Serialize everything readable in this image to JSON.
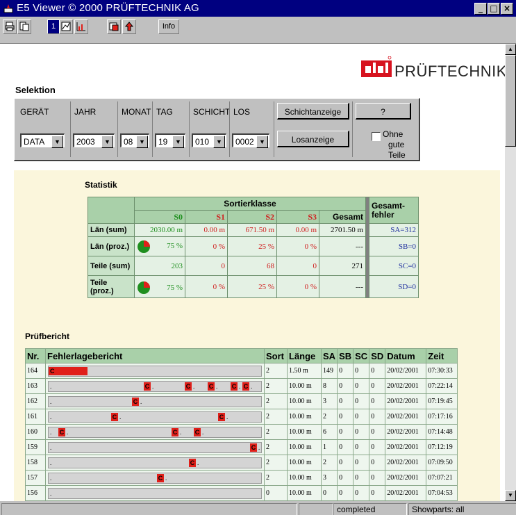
{
  "window": {
    "title": "E5 Viewer   © 2000 PRÜFTECHNIK AG"
  },
  "toolbar": {
    "info_label": "Info",
    "sheet_number": "1"
  },
  "logo": {
    "text": "PRÜFTECHNIK"
  },
  "selektion": {
    "label": "Selektion",
    "headers": [
      "GERÄT",
      "JAHR",
      "MONAT",
      "TAG",
      "SCHICHT",
      "LOS"
    ],
    "values": [
      "DATA",
      "2003",
      "08",
      "19",
      "010",
      "0002"
    ],
    "schichtanzeige_label": "Schichtanzeige",
    "help_label": "?",
    "losanzeige_label": "Losanzeige",
    "ohne_label_1": "Ohne",
    "ohne_label_2": "gute Teile"
  },
  "statistik": {
    "label": "Statistik",
    "group_header": "Sortierklasse",
    "gesamtfehler_1": "Gesamt-",
    "gesamtfehler_2": "fehler",
    "columns": [
      "S0",
      "S1",
      "S2",
      "S3",
      "Gesamt"
    ],
    "rows": [
      {
        "label": "Län (sum)",
        "values": [
          "2030.00 m",
          "0.00 m",
          "671.50 m",
          "0.00 m",
          "2701.50 m"
        ],
        "fehler": "SA=312"
      },
      {
        "label": "Län (proz.)",
        "values": [
          "75 %",
          "0 %",
          "25 %",
          "0 %",
          "---"
        ],
        "fehler": "SB=0"
      },
      {
        "label": "Teile (sum)",
        "values": [
          "203",
          "0",
          "68",
          "0",
          "271"
        ],
        "fehler": "SC=0"
      },
      {
        "label": "Teile (proz.)",
        "values": [
          "75 %",
          "0 %",
          "25 %",
          "0 %",
          "---"
        ],
        "fehler": "SD=0"
      }
    ]
  },
  "pruefbericht": {
    "label": "Prüfbericht",
    "headers": [
      "Nr.",
      "Fehlerlagebericht",
      "Sort",
      "Länge",
      "SA",
      "SB",
      "SC",
      "SD",
      "Datum",
      "Zeit"
    ],
    "rows": [
      {
        "nr": "164",
        "sort": "2",
        "laenge": "1.50 m",
        "sa": "149",
        "sb": "0",
        "sc": "0",
        "sd": "0",
        "datum": "20/02/2001",
        "zeit": "07:30:33"
      },
      {
        "nr": "163",
        "sort": "2",
        "laenge": "10.00 m",
        "sa": "8",
        "sb": "0",
        "sc": "0",
        "sd": "0",
        "datum": "20/02/2001",
        "zeit": "07:22:14"
      },
      {
        "nr": "162",
        "sort": "2",
        "laenge": "10.00 m",
        "sa": "3",
        "sb": "0",
        "sc": "0",
        "sd": "0",
        "datum": "20/02/2001",
        "zeit": "07:19:45"
      },
      {
        "nr": "161",
        "sort": "2",
        "laenge": "10.00 m",
        "sa": "2",
        "sb": "0",
        "sc": "0",
        "sd": "0",
        "datum": "20/02/2001",
        "zeit": "07:17:16"
      },
      {
        "nr": "160",
        "sort": "2",
        "laenge": "10.00 m",
        "sa": "6",
        "sb": "0",
        "sc": "0",
        "sd": "0",
        "datum": "20/02/2001",
        "zeit": "07:14:48"
      },
      {
        "nr": "159",
        "sort": "2",
        "laenge": "10.00 m",
        "sa": "1",
        "sb": "0",
        "sc": "0",
        "sd": "0",
        "datum": "20/02/2001",
        "zeit": "07:12:19"
      },
      {
        "nr": "158",
        "sort": "2",
        "laenge": "10.00 m",
        "sa": "2",
        "sb": "0",
        "sc": "0",
        "sd": "0",
        "datum": "20/02/2001",
        "zeit": "07:09:50"
      },
      {
        "nr": "157",
        "sort": "2",
        "laenge": "10.00 m",
        "sa": "3",
        "sb": "0",
        "sc": "0",
        "sd": "0",
        "datum": "20/02/2001",
        "zeit": "07:07:21"
      },
      {
        "nr": "156",
        "sort": "0",
        "laenge": "10.00 m",
        "sa": "0",
        "sb": "0",
        "sc": "0",
        "sd": "0",
        "datum": "20/02/2001",
        "zeit": "07:04:53"
      }
    ],
    "marker_letter": "C"
  },
  "status": {
    "cells": [
      "",
      "",
      "completed",
      "Showparts: all"
    ]
  },
  "colors": {
    "accent": "#000080",
    "error": "#e0201a",
    "s0": "#1f8f1f",
    "s1": "#d02020",
    "fehler": "#2030a0",
    "panel_bg": "#fbf6dc"
  }
}
